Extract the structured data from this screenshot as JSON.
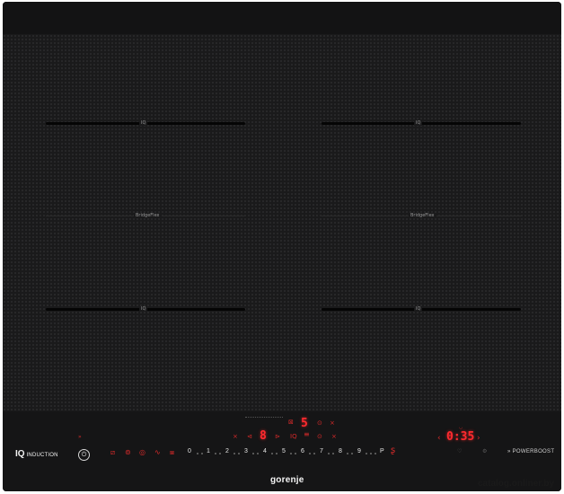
{
  "zones": {
    "top_left_mark": "IQ",
    "top_right_mark": "IQ",
    "bottom_left_mark": "IQ",
    "bottom_right_mark": "IQ",
    "bridge_left": "BridgeFlex",
    "bridge_right": "BridgeFlex"
  },
  "display": {
    "center_level": "5",
    "left_level": "8",
    "timer_value": "0:35"
  },
  "panel": {
    "brand_iq": "IQ",
    "brand_induction": "INDUCTION",
    "power_symbol": "⏻",
    "power_boost": "POWERBOOST",
    "boost_arrows": "»",
    "slider_levels": [
      "0",
      "1",
      "2",
      "3",
      "4",
      "5",
      "6",
      "7",
      "8",
      "9",
      "P"
    ],
    "logo": "gorenje"
  },
  "watermark": "catalog.onliner.by",
  "colors": {
    "glass": "#1a1a1b",
    "led_red": "#ff2a2f",
    "text_white": "#f2f2f2"
  }
}
